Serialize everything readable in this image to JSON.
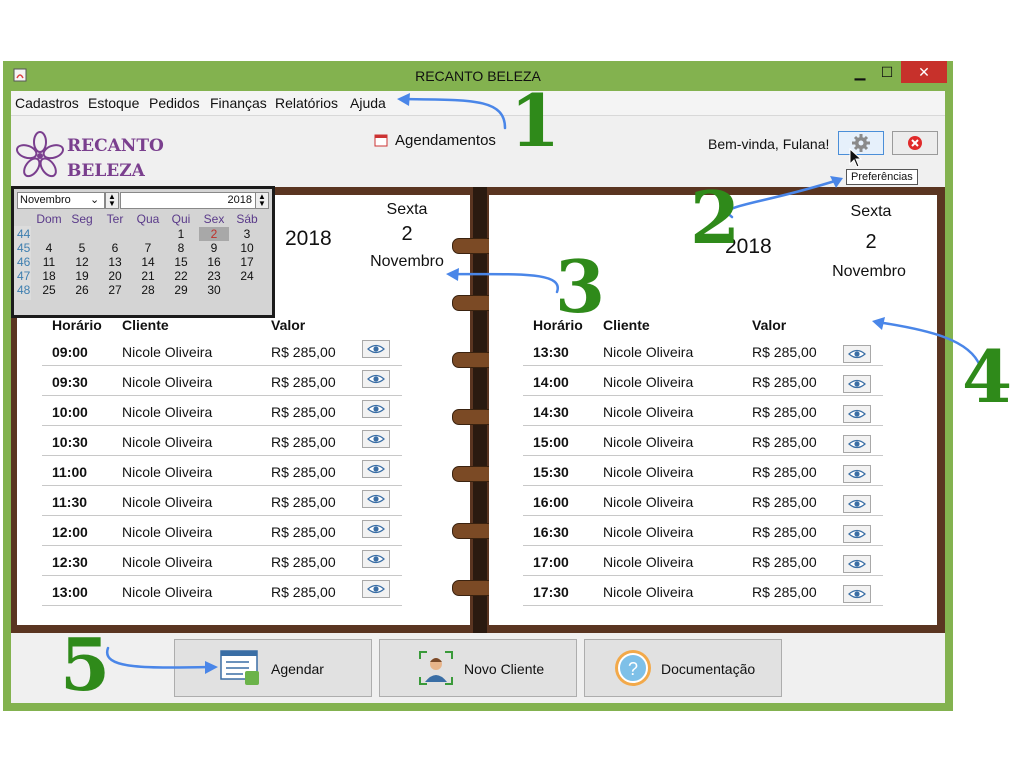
{
  "window": {
    "title": "RECANTO BELEZA",
    "controls": {
      "minimize": "▁",
      "maximize": "☐",
      "close": "✕"
    }
  },
  "menu": [
    "Cadastros",
    "Estoque",
    "Pedidos",
    "Finanças",
    "Relatórios",
    "Ajuda"
  ],
  "header": {
    "logo_line1": "RECANTO",
    "logo_line2": "BELEZA",
    "agendamentos": "Agendamentos",
    "welcome": "Bem-vinda, Fulana!",
    "preferences_tooltip": "Preferências"
  },
  "calendar": {
    "month": "Novembro",
    "year": "2018",
    "day_names": [
      "Dom",
      "Seg",
      "Ter",
      "Qua",
      "Qui",
      "Sex",
      "Sáb"
    ],
    "weeks": [
      {
        "num": "44",
        "days": [
          "",
          "",
          "",
          "",
          "1",
          "2",
          "3"
        ]
      },
      {
        "num": "45",
        "days": [
          "4",
          "5",
          "6",
          "7",
          "8",
          "9",
          "10"
        ]
      },
      {
        "num": "46",
        "days": [
          "11",
          "12",
          "13",
          "14",
          "15",
          "16",
          "17"
        ]
      },
      {
        "num": "47",
        "days": [
          "18",
          "19",
          "20",
          "21",
          "22",
          "23",
          "24"
        ]
      },
      {
        "num": "48",
        "days": [
          "25",
          "26",
          "27",
          "28",
          "29",
          "30",
          ""
        ]
      }
    ],
    "selected_day": "2"
  },
  "left_page": {
    "year": "2018",
    "weekday": "Sexta",
    "day": "2",
    "month": "Novembro",
    "headers": {
      "time": "Horário",
      "client": "Cliente",
      "value": "Valor"
    },
    "rows": [
      {
        "time": "09:00",
        "client": "Nicole Oliveira",
        "value": "R$ 285,00"
      },
      {
        "time": "09:30",
        "client": "Nicole Oliveira",
        "value": "R$ 285,00"
      },
      {
        "time": "10:00",
        "client": "Nicole Oliveira",
        "value": "R$ 285,00"
      },
      {
        "time": "10:30",
        "client": "Nicole Oliveira",
        "value": "R$ 285,00"
      },
      {
        "time": "11:00",
        "client": "Nicole Oliveira",
        "value": "R$ 285,00"
      },
      {
        "time": "11:30",
        "client": "Nicole Oliveira",
        "value": "R$ 285,00"
      },
      {
        "time": "12:00",
        "client": "Nicole Oliveira",
        "value": "R$ 285,00"
      },
      {
        "time": "12:30",
        "client": "Nicole Oliveira",
        "value": "R$ 285,00"
      },
      {
        "time": "13:00",
        "client": "Nicole Oliveira",
        "value": "R$ 285,00"
      }
    ]
  },
  "right_page": {
    "year": "2018",
    "weekday": "Sexta",
    "day": "2",
    "month": "Novembro",
    "headers": {
      "time": "Horário",
      "client": "Cliente",
      "value": "Valor"
    },
    "rows": [
      {
        "time": "13:30",
        "client": "Nicole Oliveira",
        "value": "R$ 285,00"
      },
      {
        "time": "14:00",
        "client": "Nicole Oliveira",
        "value": "R$ 285,00"
      },
      {
        "time": "14:30",
        "client": "Nicole Oliveira",
        "value": "R$ 285,00"
      },
      {
        "time": "15:00",
        "client": "Nicole Oliveira",
        "value": "R$ 285,00"
      },
      {
        "time": "15:30",
        "client": "Nicole Oliveira",
        "value": "R$ 285,00"
      },
      {
        "time": "16:00",
        "client": "Nicole Oliveira",
        "value": "R$ 285,00"
      },
      {
        "time": "16:30",
        "client": "Nicole Oliveira",
        "value": "R$ 285,00"
      },
      {
        "time": "17:00",
        "client": "Nicole Oliveira",
        "value": "R$ 285,00"
      },
      {
        "time": "17:30",
        "client": "Nicole Oliveira",
        "value": "R$ 285,00"
      }
    ]
  },
  "buttons": {
    "agendar": "Agendar",
    "novo_cliente": "Novo Cliente",
    "documentacao": "Documentação"
  },
  "annotations": [
    "1",
    "2",
    "3",
    "4",
    "5"
  ],
  "colors": {
    "window_border": "#83b24f",
    "planner_wood": "#5a3521",
    "logo": "#7a3f8e",
    "annotation": "#2f8a1a",
    "arrow": "#4a86e8"
  }
}
